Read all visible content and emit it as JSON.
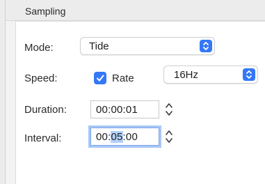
{
  "group": {
    "title": "Sampling"
  },
  "mode": {
    "label": "Mode:",
    "value": "Tide"
  },
  "speed": {
    "label": "Speed:",
    "checkbox_label": "Rate",
    "checked": true,
    "rate_value": "16Hz"
  },
  "duration": {
    "label": "Duration:",
    "value": "00:00:01"
  },
  "interval": {
    "label": "Interval:",
    "value_prefix": "00:",
    "value_selected": "05",
    "value_suffix": ":00"
  },
  "colors": {
    "accent": "#3478f6",
    "selection": "#b3d1fb",
    "focus_ring": "#a9c7f5"
  }
}
